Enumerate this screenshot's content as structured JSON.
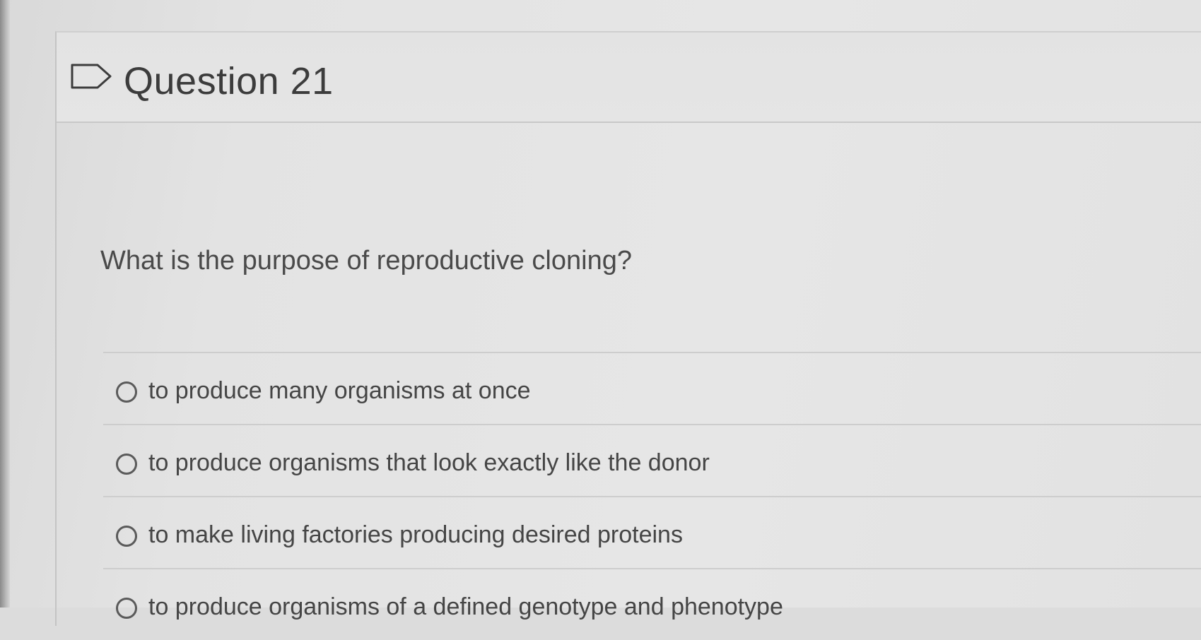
{
  "question": {
    "title": "Question 21",
    "text": "What is the purpose of reproductive cloning?",
    "flag_icon": "flag-outline-icon",
    "answers": [
      {
        "label": "to produce many organisms at once",
        "selected": false
      },
      {
        "label": "to produce organisms that look exactly like the donor",
        "selected": false
      },
      {
        "label": "to make living factories producing desired proteins",
        "selected": false
      },
      {
        "label": "to produce organisms of a defined genotype and phenotype",
        "selected": false
      }
    ]
  },
  "colors": {
    "background": "#e4e4e4",
    "text": "#444444",
    "divider": "#cccccc",
    "radio_border": "#5a5a5a"
  }
}
